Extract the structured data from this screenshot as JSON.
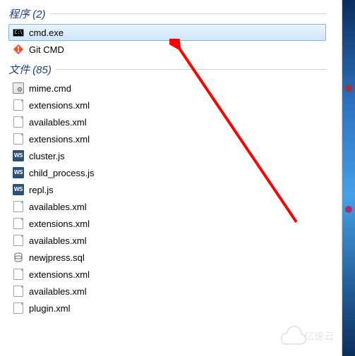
{
  "sections": {
    "programs": {
      "title": "程序 (2)"
    },
    "files": {
      "title": "文件 (85)"
    }
  },
  "programs": [
    {
      "label": "cmd.exe",
      "icon": "cmd-icon",
      "selected": true
    },
    {
      "label": "Git CMD",
      "icon": "git-icon",
      "selected": false
    }
  ],
  "files": [
    {
      "label": "mime.cmd",
      "icon": "mime-icon"
    },
    {
      "label": "extensions.xml",
      "icon": "file-icon"
    },
    {
      "label": "availables.xml",
      "icon": "file-icon"
    },
    {
      "label": "extensions.xml",
      "icon": "file-icon"
    },
    {
      "label": "cluster.js",
      "icon": "ws-icon"
    },
    {
      "label": "child_process.js",
      "icon": "ws-icon"
    },
    {
      "label": "repl.js",
      "icon": "ws-icon"
    },
    {
      "label": "availables.xml",
      "icon": "file-icon"
    },
    {
      "label": "extensions.xml",
      "icon": "file-icon"
    },
    {
      "label": "availables.xml",
      "icon": "file-icon"
    },
    {
      "label": "newjpress.sql",
      "icon": "sql-icon"
    },
    {
      "label": "extensions.xml",
      "icon": "file-icon"
    },
    {
      "label": "availables.xml",
      "icon": "file-icon"
    },
    {
      "label": "plugin.xml",
      "icon": "file-icon"
    }
  ],
  "watermark": "亿速云",
  "annotation": {
    "arrow_target": "cmd.exe",
    "arrow_color": "#ff0000"
  }
}
